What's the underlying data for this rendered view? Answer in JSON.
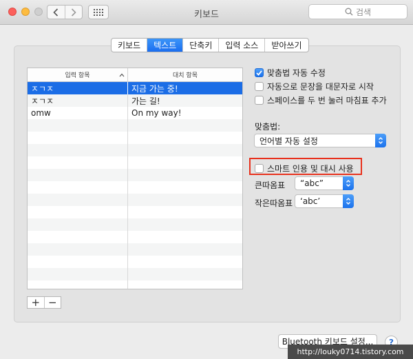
{
  "window": {
    "title": "키보드"
  },
  "search": {
    "placeholder": "검색"
  },
  "tabs": [
    {
      "label": "키보드",
      "active": false
    },
    {
      "label": "텍스트",
      "active": true
    },
    {
      "label": "단축키",
      "active": false
    },
    {
      "label": "입력 소스",
      "active": false
    },
    {
      "label": "받아쓰기",
      "active": false
    }
  ],
  "table": {
    "columns": [
      "입력 항목",
      "대치 항목"
    ],
    "rows": [
      {
        "replace": "ㅈㄱㅈ",
        "with": "지금 가는 중!",
        "selected": true
      },
      {
        "replace": "ㅈㄱㅈ",
        "with": "가는 길!",
        "selected": false
      },
      {
        "replace": "omw",
        "with": "On my way!",
        "selected": false
      }
    ],
    "empty_rows": 14
  },
  "table_controls": {
    "add": "+",
    "remove": "−"
  },
  "options": {
    "autocorrect": {
      "label": "맞춤법 자동 수정",
      "checked": true
    },
    "auto_capitalize": {
      "label": "자동으로 문장을 대문자로 시작",
      "checked": false
    },
    "double_space_period": {
      "label": "스페이스를 두 번 눌러 마침표 추가",
      "checked": false
    },
    "spelling_label": "맞춤법:",
    "spelling_value": "언어별 자동 설정",
    "smart_quotes": {
      "label": "스마트 인용 및 대시 사용",
      "checked": false
    },
    "double_quotes_label": "큰따옴표",
    "double_quotes_value": "“abc”",
    "single_quotes_label": "작은따옴표",
    "single_quotes_value": "‘abc’"
  },
  "footer": {
    "bluetooth_button": "Bluetooth 키보드 설정...",
    "help": "?",
    "watermark": "http://louky0714.tistory.com"
  },
  "colors": {
    "accent": "#1b6de6",
    "highlight_box": "#e8301c"
  }
}
